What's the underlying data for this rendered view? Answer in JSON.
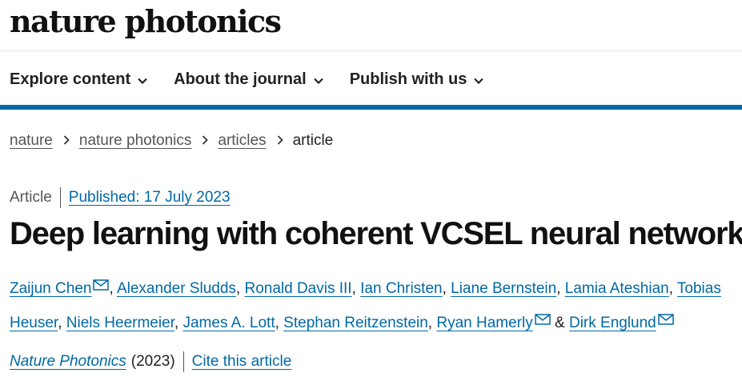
{
  "header": {
    "logo_text": "nature photonics"
  },
  "nav": {
    "items": [
      {
        "label": "Explore content"
      },
      {
        "label": "About the journal"
      },
      {
        "label": "Publish with us"
      }
    ]
  },
  "breadcrumb": {
    "items": [
      "nature",
      "nature photonics",
      "articles"
    ],
    "current": "article"
  },
  "article": {
    "type": "Article",
    "published": "Published: 17 July 2023",
    "title": "Deep learning with coherent VCSEL neural networks",
    "authors": [
      {
        "name": "Zaijun Chen",
        "email": true
      },
      {
        "name": "Alexander Sludds",
        "email": false
      },
      {
        "name": "Ronald Davis III",
        "email": false
      },
      {
        "name": "Ian Christen",
        "email": false
      },
      {
        "name": "Liane Bernstein",
        "email": false
      },
      {
        "name": "Lamia Ateshian",
        "email": false
      },
      {
        "name": "Tobias Heuser",
        "email": false
      },
      {
        "name": "Niels Heermeier",
        "email": false
      },
      {
        "name": "James A. Lott",
        "email": false
      },
      {
        "name": "Stephan Reitzenstein",
        "email": false
      },
      {
        "name": "Ryan Hamerly",
        "email": true
      },
      {
        "name": "Dirk Englund",
        "email": true
      }
    ],
    "journal": "Nature Photonics",
    "year": "(2023)",
    "cite_label": "Cite this article"
  },
  "colors": {
    "link": "#0069a6",
    "accent_bar": "#0069a6",
    "text": "#222222"
  },
  "icons": {
    "nav_chevron": "chevron-down-icon",
    "breadcrumb_separator": "chevron-right-icon",
    "author_email": "mail-icon"
  }
}
